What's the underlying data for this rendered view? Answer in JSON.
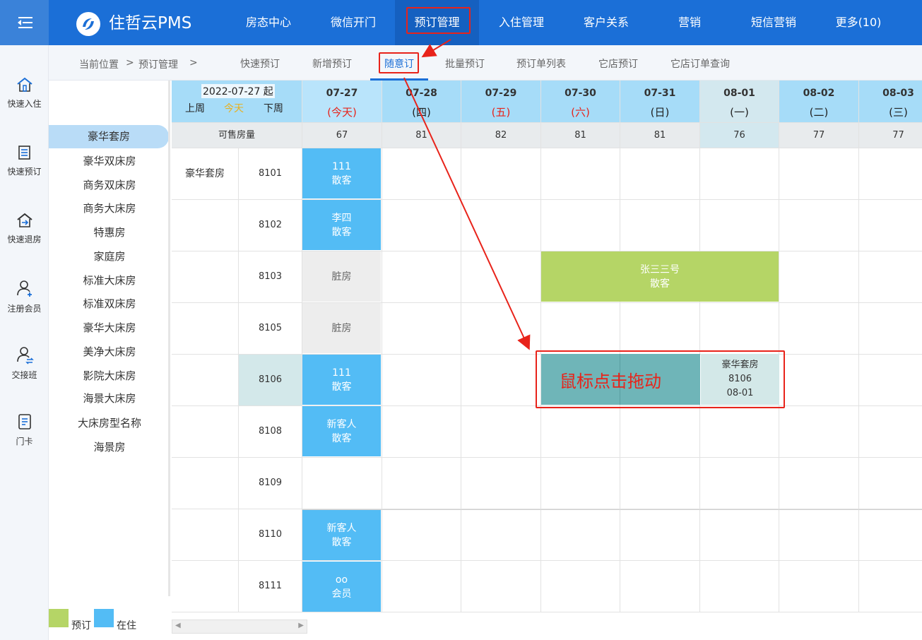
{
  "app": {
    "brand": "住哲云PMS"
  },
  "nav": {
    "items": [
      "房态中心",
      "微信开门",
      "预订管理",
      "入住管理",
      "客户关系",
      "营销",
      "短信营销",
      "更多(10)"
    ],
    "active": "预订管理"
  },
  "breadcrumb": {
    "prefix": "当前位置",
    "sep1": ">",
    "current": "预订管理",
    "sep2": ">"
  },
  "subnav": {
    "items": [
      "快速预订",
      "新增预订",
      "随意订",
      "批量预订",
      "预订单列表",
      "它店预订",
      "它店订单查询"
    ],
    "active": "随意订"
  },
  "sidebar": {
    "items": [
      {
        "label": "快速入住",
        "icon": "home-checkin-icon"
      },
      {
        "label": "快速预订",
        "icon": "document-list-icon"
      },
      {
        "label": "快速退房",
        "icon": "home-checkout-icon"
      },
      {
        "label": "注册会员",
        "icon": "user-add-icon"
      },
      {
        "label": "交接班",
        "icon": "user-swap-icon"
      },
      {
        "label": "门卡",
        "icon": "card-icon"
      }
    ]
  },
  "room_types": {
    "items": [
      "豪华套房",
      "豪华双床房",
      "商务双床房",
      "商务大床房",
      "特惠房",
      "家庭房",
      "标准大床房",
      "标准双床房",
      "豪华大床房",
      "美净大床房",
      "影院大床房",
      "海景大床房",
      "大床房型名称",
      "海景房"
    ],
    "selected": "豪华套房"
  },
  "calendar": {
    "start_label": "2022-07-27 起",
    "prev_week": "上周",
    "today": "今天",
    "next_week": "下周",
    "avail_label": "可售房量",
    "days": [
      {
        "date": "07-27",
        "week": "(今天)",
        "avail": "67",
        "red": true
      },
      {
        "date": "07-28",
        "week": "(四)",
        "avail": "81",
        "red": false
      },
      {
        "date": "07-29",
        "week": "(五)",
        "avail": "82",
        "red": true
      },
      {
        "date": "07-30",
        "week": "(六)",
        "avail": "81",
        "red": true
      },
      {
        "date": "07-31",
        "week": "(日)",
        "avail": "81",
        "red": false
      },
      {
        "date": "08-01",
        "week": "(一)",
        "avail": "76",
        "red": false
      },
      {
        "date": "08-02",
        "week": "(二)",
        "avail": "77",
        "red": false
      },
      {
        "date": "08-03",
        "week": "(三)",
        "avail": "77",
        "red": false
      }
    ],
    "room_type": "豪华套房",
    "rooms": [
      "8101",
      "8102",
      "8103",
      "8105",
      "8106",
      "8108",
      "8109",
      "8110",
      "8111"
    ]
  },
  "bookings": [
    {
      "room": "8101",
      "name": "111",
      "type": "散客",
      "status": "stay"
    },
    {
      "room": "8102",
      "name": "李四",
      "type": "散客",
      "status": "stay"
    },
    {
      "room": "8103",
      "name": "脏房",
      "status": "dirty"
    },
    {
      "room": "8103",
      "name": "张三三号",
      "type": "散客",
      "status": "book"
    },
    {
      "room": "8105",
      "name": "脏房",
      "status": "dirty"
    },
    {
      "room": "8106",
      "name": "111",
      "type": "散客",
      "status": "stay"
    },
    {
      "room": "8108",
      "name": "新客人",
      "type": "散客",
      "status": "stay"
    },
    {
      "room": "8110",
      "name": "新客人",
      "type": "散客",
      "status": "stay"
    },
    {
      "room": "8111",
      "name": "oo",
      "type": "会员",
      "status": "stay"
    }
  ],
  "drag": {
    "label": "鼠标点击拖动",
    "info_type": "豪华套房",
    "info_room": "8106",
    "info_date": "08-01"
  },
  "legend": {
    "book": "预订",
    "stay": "在住"
  },
  "colors": {
    "brand": "#1b6fd7",
    "stay": "#53bcf5",
    "book": "#b5d566",
    "annotation": "#e8231a",
    "header": "#a6dcf8",
    "drag": "#6fb5b8"
  }
}
